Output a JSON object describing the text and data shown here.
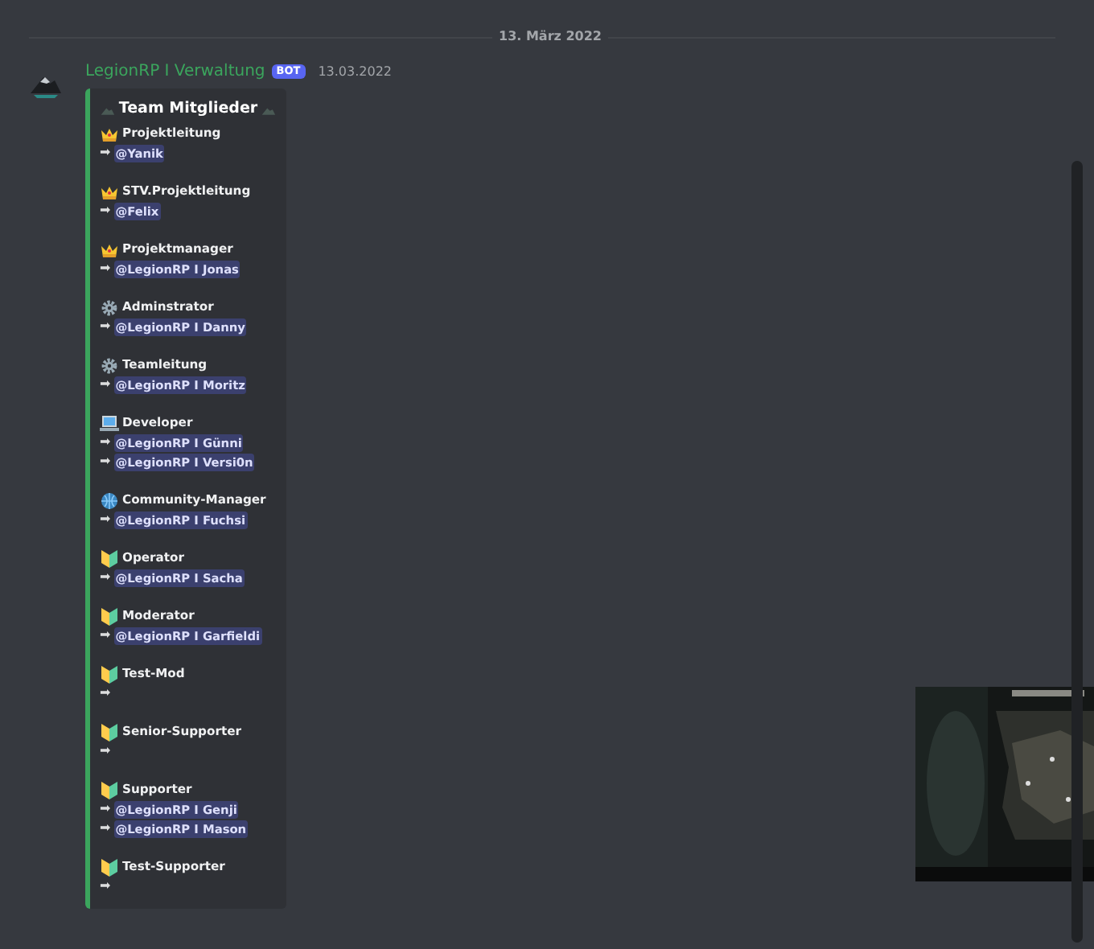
{
  "date_divider": "13. März 2022",
  "message": {
    "author": "LegionRP I Verwaltung",
    "badge": "BOT",
    "timestamp": "13.03.2022",
    "embed": {
      "title": "Team Mitglieder",
      "sections": [
        {
          "kind": "crown",
          "title": "Projektleitung",
          "lines": [
            {
              "arrow": "➡",
              "mention": "@Yanik"
            }
          ]
        },
        {
          "kind": "crown",
          "title": "STV.Projektleitung",
          "lines": [
            {
              "arrow": "➡",
              "mention": "@Felix"
            }
          ]
        },
        {
          "kind": "crown",
          "title": "Projektmanager",
          "lines": [
            {
              "arrow": "➡",
              "mention": "@LegionRP I Jonas"
            }
          ]
        },
        {
          "kind": "gear",
          "title": "Adminstrator",
          "lines": [
            {
              "arrow": "➡",
              "mention": "@LegionRP I Danny"
            }
          ]
        },
        {
          "kind": "gear",
          "title": "Teamleitung",
          "lines": [
            {
              "arrow": "➡",
              "mention": "@LegionRP I Moritz"
            }
          ]
        },
        {
          "kind": "laptop",
          "title": "Developer",
          "lines": [
            {
              "arrow": "➡",
              "mention": "@LegionRP I Günni"
            },
            {
              "arrow": "➡",
              "mention": "@LegionRP I Versi0n"
            }
          ]
        },
        {
          "kind": "globe",
          "title": "Community-Manager",
          "lines": [
            {
              "arrow": "➡",
              "mention": "@LegionRP I Fuchsi"
            }
          ]
        },
        {
          "kind": "beginner",
          "title": "Operator",
          "lines": [
            {
              "arrow": "➡",
              "mention": "@LegionRP I Sacha"
            }
          ]
        },
        {
          "kind": "beginner",
          "title": "Moderator",
          "lines": [
            {
              "arrow": "➡",
              "mention": "@LegionRP I Garfieldi"
            }
          ]
        },
        {
          "kind": "beginner",
          "title": "Test-Mod",
          "lines": [
            {
              "arrow": "➡"
            }
          ]
        },
        {
          "kind": "beginner",
          "title": "Senior-Supporter",
          "lines": [
            {
              "arrow": "➡"
            }
          ]
        },
        {
          "kind": "beginner",
          "title": "Supporter",
          "lines": [
            {
              "arrow": "➡",
              "mention": "@LegionRP I Genji"
            },
            {
              "arrow": "➡",
              "mention": "@LegionRP I Mason"
            }
          ]
        },
        {
          "kind": "beginner",
          "title": "Test-Supporter",
          "lines": [
            {
              "arrow": "➡"
            }
          ]
        }
      ]
    }
  }
}
